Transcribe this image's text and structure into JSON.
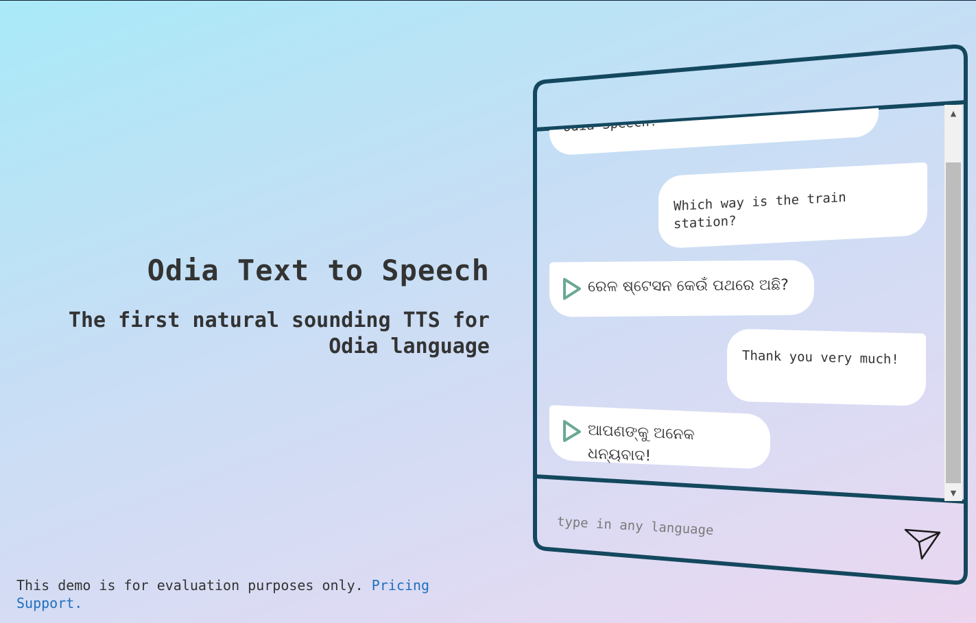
{
  "hero": {
    "title": "Odia Text to Speech",
    "subtitle": "The first natural sounding TTS for Odia language"
  },
  "footer": {
    "text": "This demo is for evaluation purposes only.",
    "link_text": "Pricing Support."
  },
  "chat": {
    "messages": [
      {
        "role": "bot",
        "text": "Type anything... to convert to Odia Speech!",
        "visible_text": "Odia Speech!"
      },
      {
        "role": "user",
        "text": "Which way is the train station?"
      },
      {
        "role": "bot",
        "text": "ରେଳ ଷ୍ଟେସନ କେଉଁ ପଥରେ ଅଛି?",
        "has_audio": true
      },
      {
        "role": "user",
        "text": "Thank you very much!"
      },
      {
        "role": "bot",
        "text": "ଆପଣଙ୍କୁ ଅନେକ ଧନ୍ୟବାଦ!",
        "has_audio": true
      }
    ],
    "input_placeholder": "type in any language"
  },
  "icons": {
    "play": "play-icon",
    "send": "send-icon",
    "scroll_up": "scroll-up-arrow-icon",
    "scroll_down": "scroll-down-arrow-icon"
  },
  "colors": {
    "frame": "#14485e",
    "play_icon": "#6aa894",
    "link": "#1f6fbf",
    "text": "#333333",
    "bubble": "#ffffff"
  }
}
